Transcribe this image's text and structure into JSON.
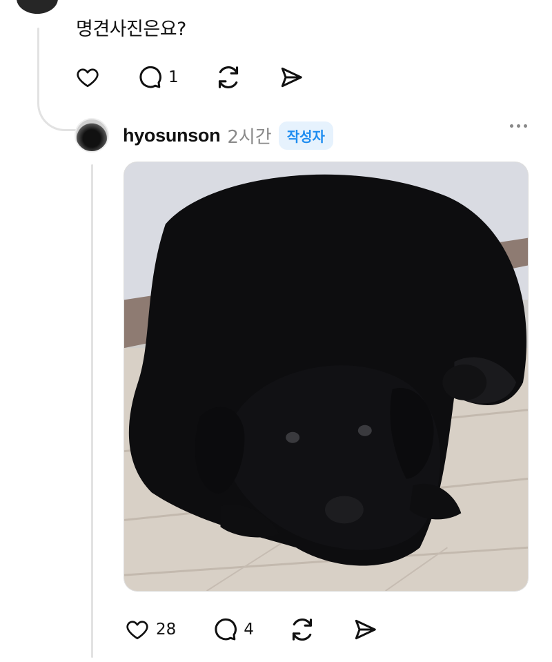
{
  "parent_comment": {
    "text": "명견사진은요?",
    "actions": {
      "like_count": "",
      "reply_count": "1"
    }
  },
  "reply": {
    "username": "hyosunson",
    "time": "2시간",
    "author_badge": "작성자",
    "actions": {
      "like_count": "28",
      "reply_count": "4"
    }
  },
  "icons": {
    "like": "heart-icon",
    "reply": "comment-bubble-icon",
    "repost": "repost-icon",
    "share": "send-icon",
    "more": "more-options-icon"
  },
  "colors": {
    "badge_text": "#1d8cf0",
    "badge_bg": "#e6f2fd",
    "muted": "#8a8a8a"
  }
}
